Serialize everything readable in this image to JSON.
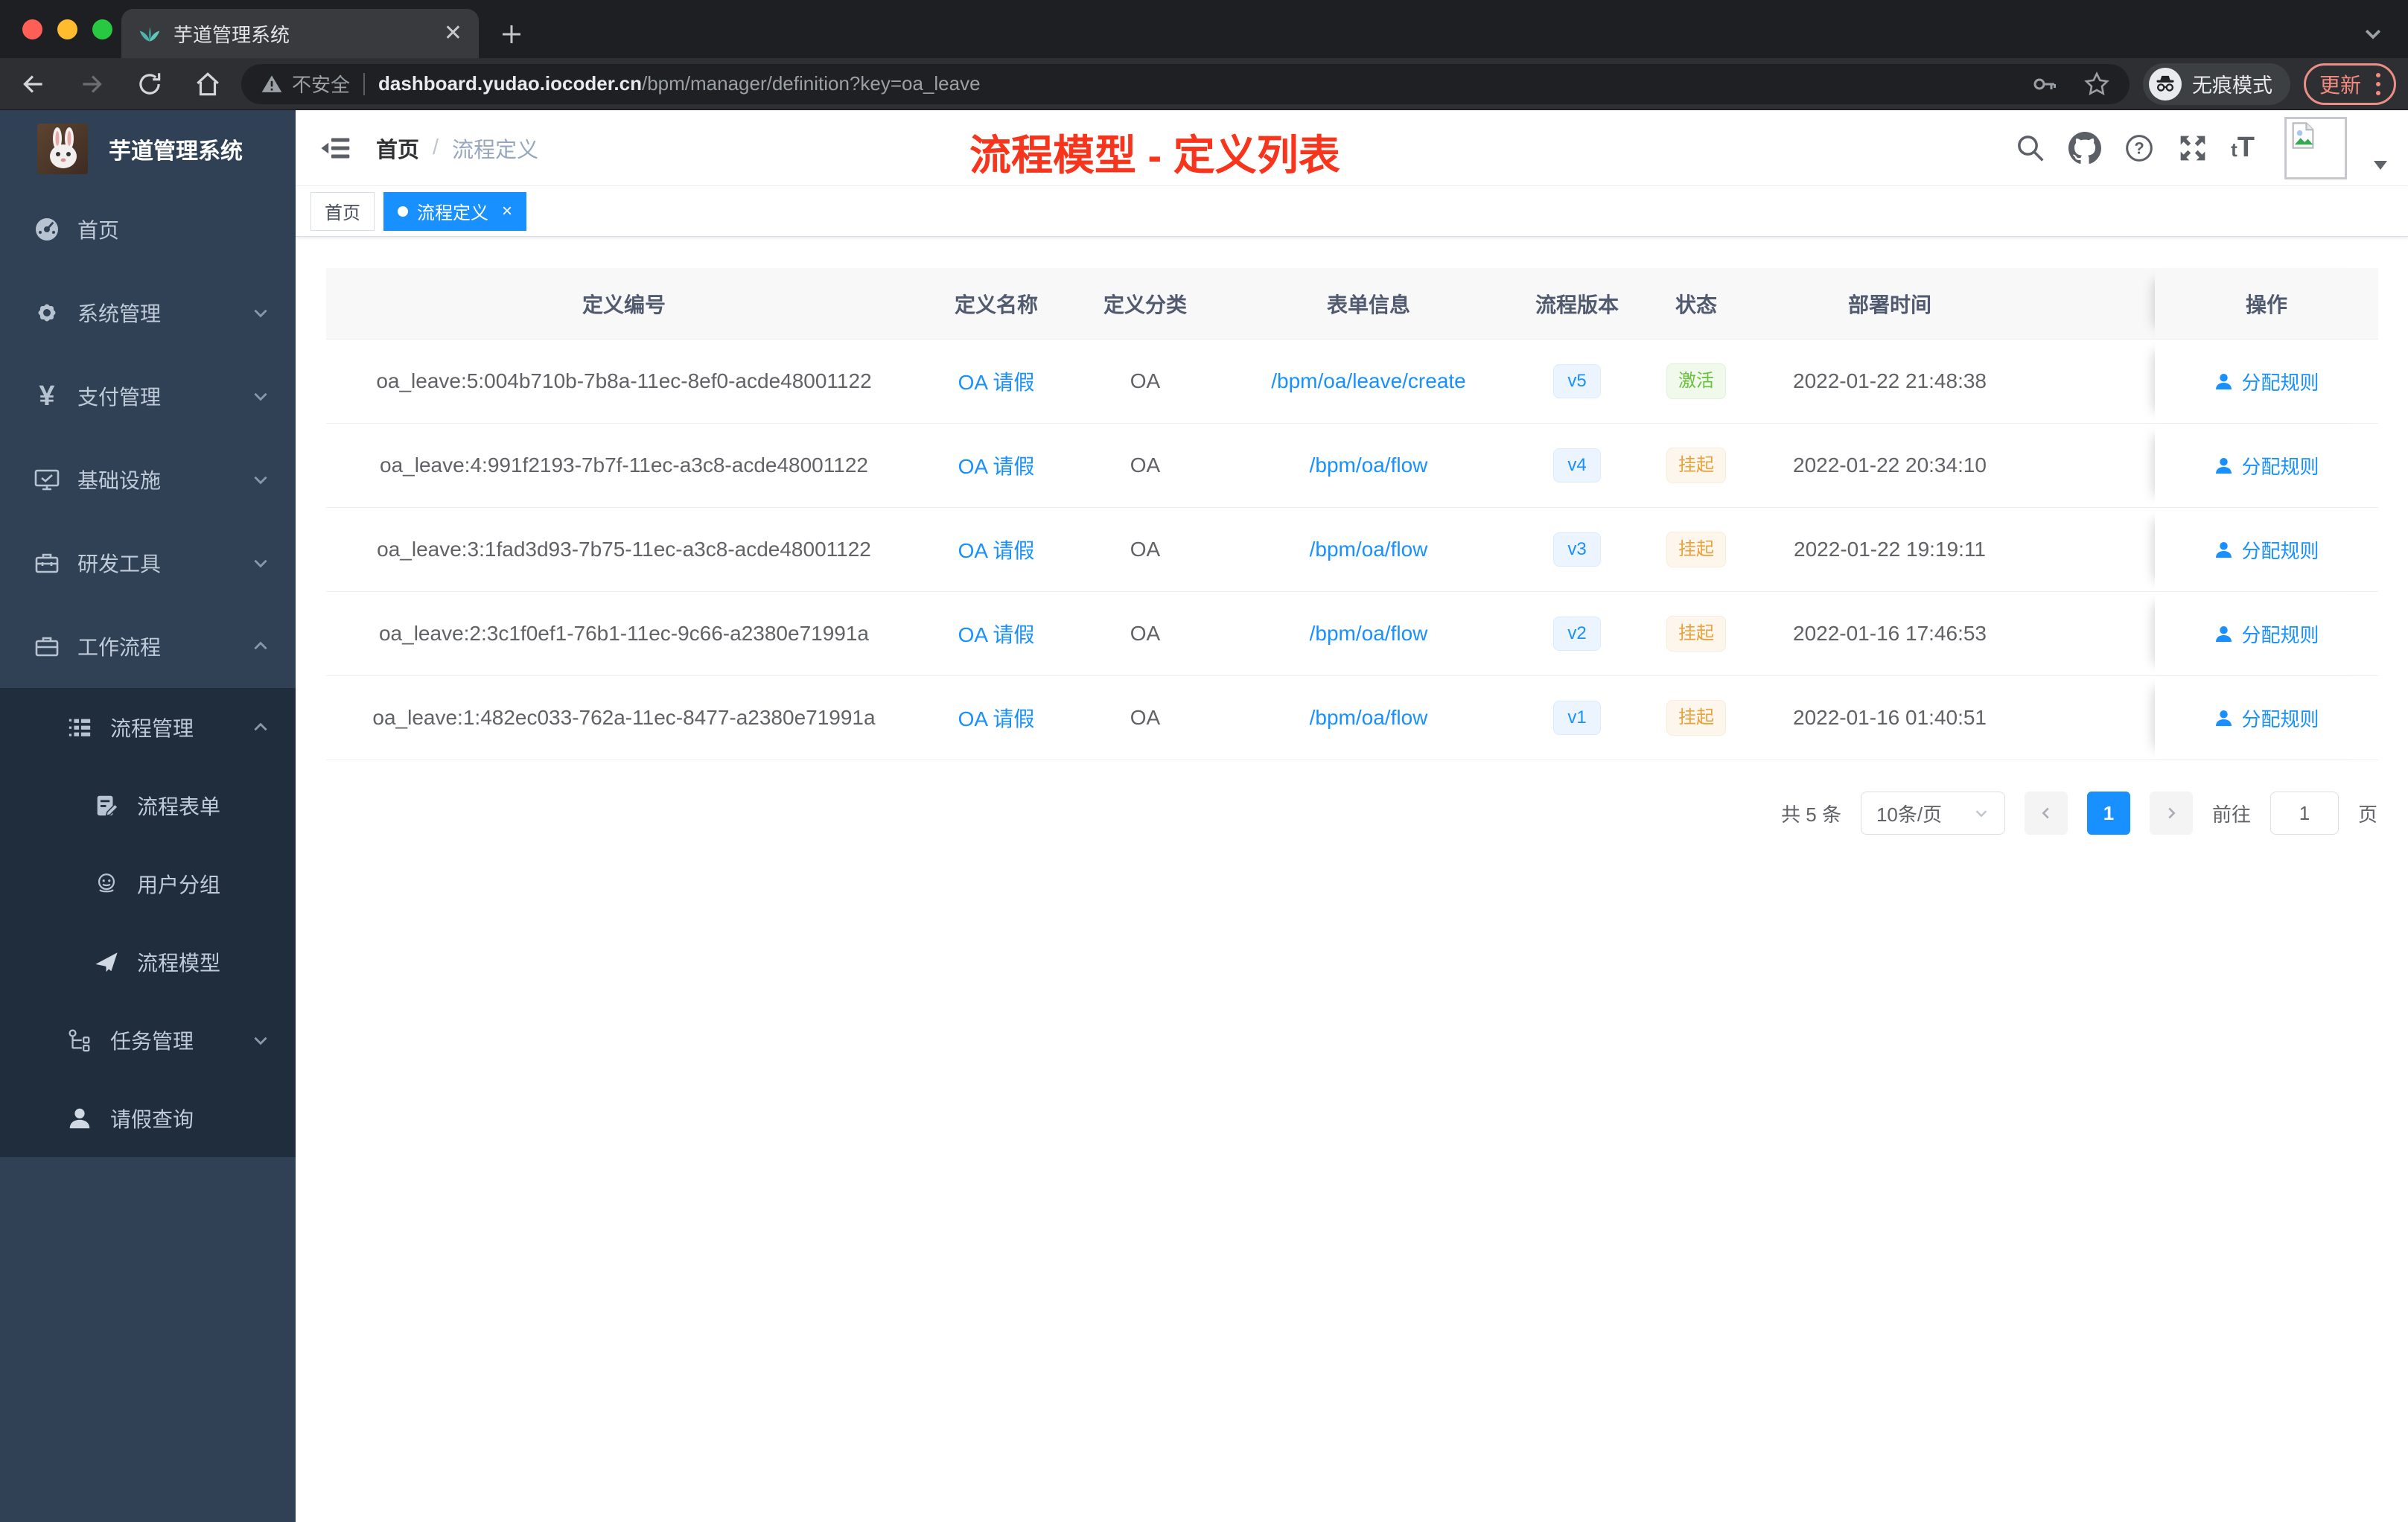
{
  "colors": {
    "accent": "#1890ff",
    "success": "#67c23a",
    "warning": "#e6a23c",
    "annotation": "#f7341c",
    "sidebar-bg": "#304156",
    "submenu-bg": "#1f2d3d",
    "sidebar-text": "#bfcbd9"
  },
  "browser": {
    "tab_title": "芋道管理系统",
    "new_tab_icon": "plus",
    "security_label": "不安全",
    "url_domain": "dashboard.yudao.iocoder.cn",
    "url_path": "/bpm/manager/definition?key=oa_leave",
    "incognito_label": "无痕模式",
    "update_label": "更新",
    "toolbar_icons": [
      "back-arrow",
      "forward-arrow",
      "reload",
      "home",
      "key",
      "bookmark-star",
      "menu-dots"
    ]
  },
  "sidebar": {
    "logo_title": "芋道管理系统",
    "items": [
      {
        "label": "首页",
        "icon": "dashboard-icon"
      },
      {
        "label": "系统管理",
        "icon": "gear-icon"
      },
      {
        "label": "支付管理",
        "icon": "yen-icon"
      },
      {
        "label": "基础设施",
        "icon": "monitor-icon"
      },
      {
        "label": "研发工具",
        "icon": "toolbox-icon"
      },
      {
        "label": "工作流程",
        "icon": "briefcase-icon"
      },
      {
        "label": "流程管理",
        "icon": "list-icon"
      },
      {
        "label": "流程表单",
        "icon": "form-icon"
      },
      {
        "label": "用户分组",
        "icon": "group-icon"
      },
      {
        "label": "流程模型",
        "icon": "plane-icon"
      },
      {
        "label": "任务管理",
        "icon": "tree-icon"
      },
      {
        "label": "请假查询",
        "icon": "person-icon"
      }
    ]
  },
  "header": {
    "breadcrumb_home": "首页",
    "breadcrumb_sep": "/",
    "breadcrumb_current": "流程定义",
    "annotation": "流程模型 - 定义列表",
    "right_icons": [
      "search",
      "github",
      "help",
      "fullscreen",
      "font-size",
      "avatar",
      "caret-down"
    ]
  },
  "tags": {
    "home": "首页",
    "active": "流程定义",
    "close": "×"
  },
  "table": {
    "columns": [
      "定义编号",
      "定义名称",
      "定义分类",
      "表单信息",
      "流程版本",
      "状态",
      "部署时间",
      "操作"
    ],
    "rows": [
      {
        "id": "oa_leave:5:004b710b-7b8a-11ec-8ef0-acde48001122",
        "name": "OA 请假",
        "category": "OA",
        "form": "/bpm/oa/leave/create",
        "version": "v5",
        "status": "激活",
        "time": "2022-01-22 21:48:38",
        "action": "分配规则"
      },
      {
        "id": "oa_leave:4:991f2193-7b7f-11ec-a3c8-acde48001122",
        "name": "OA 请假",
        "category": "OA",
        "form": "/bpm/oa/flow",
        "version": "v4",
        "status": "挂起",
        "time": "2022-01-22 20:34:10",
        "action": "分配规则"
      },
      {
        "id": "oa_leave:3:1fad3d93-7b75-11ec-a3c8-acde48001122",
        "name": "OA 请假",
        "category": "OA",
        "form": "/bpm/oa/flow",
        "version": "v3",
        "status": "挂起",
        "time": "2022-01-22 19:19:11",
        "action": "分配规则"
      },
      {
        "id": "oa_leave:2:3c1f0ef1-76b1-11ec-9c66-a2380e71991a",
        "name": "OA 请假",
        "category": "OA",
        "form": "/bpm/oa/flow",
        "version": "v2",
        "status": "挂起",
        "time": "2022-01-16 17:46:53",
        "action": "分配规则"
      },
      {
        "id": "oa_leave:1:482ec033-762a-11ec-8477-a2380e71991a",
        "name": "OA 请假",
        "category": "OA",
        "form": "/bpm/oa/flow",
        "version": "v1",
        "status": "挂起",
        "time": "2022-01-16 01:40:51",
        "action": "分配规则"
      }
    ]
  },
  "pagination": {
    "total": "共 5 条",
    "page_size": "10条/页",
    "page": "1",
    "goto_label": "前往",
    "goto_value": "1",
    "unit": "页"
  }
}
